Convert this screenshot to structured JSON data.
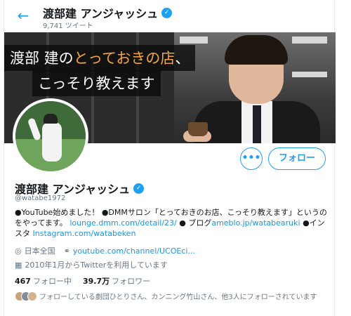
{
  "header": {
    "back_glyph": "←",
    "name": "渡部建 アンジャッシュ",
    "tweet_count": "9,741 ツイート"
  },
  "banner": {
    "line1_a": "渡部 建の",
    "line1_b": "とっておきの店",
    "line1_c": "、",
    "line2": "こっそり教えます"
  },
  "actions": {
    "more_glyph": "•••",
    "follow_label": "フォロー"
  },
  "profile": {
    "name": "渡部建 アンジャッシュ",
    "verified_glyph": "✓",
    "handle": "@watabe1972"
  },
  "bio": {
    "p1": "●YouTube始めました！ ●DMMサロン「とっておきのお店、こっそり教えます」というのをやってます。",
    "link1": "lounge.dmm.com/detail/23/",
    "p2": " ● ブログ",
    "link2": "ameblo.jp/watabearuki",
    "p3": " ●インスタ ",
    "link3": "Instagram.com/watabeken"
  },
  "meta": {
    "location": "日本全国",
    "url": "youtube.com/channel/UCOEci...",
    "joined": "2010年1月からTwitterを利用しています"
  },
  "stats": {
    "following_count": "467",
    "following_label": "フォロー中",
    "followers_count": "39.7万",
    "followers_label": "フォロワー"
  },
  "followed_by": {
    "text": "フォローしている劇団ひとりさん、カンニング竹山さん、他3人にフォローされています"
  },
  "icons": {
    "back": "back-arrow-icon",
    "verified": "verified-badge-icon",
    "location": "location-pin-icon",
    "link": "link-icon",
    "calendar": "calendar-icon",
    "more": "more-icon"
  },
  "colors": {
    "accent": "#1da1f2",
    "link": "#1b95e0",
    "muted": "#657786",
    "banner_highlight": "#f4a53c"
  }
}
